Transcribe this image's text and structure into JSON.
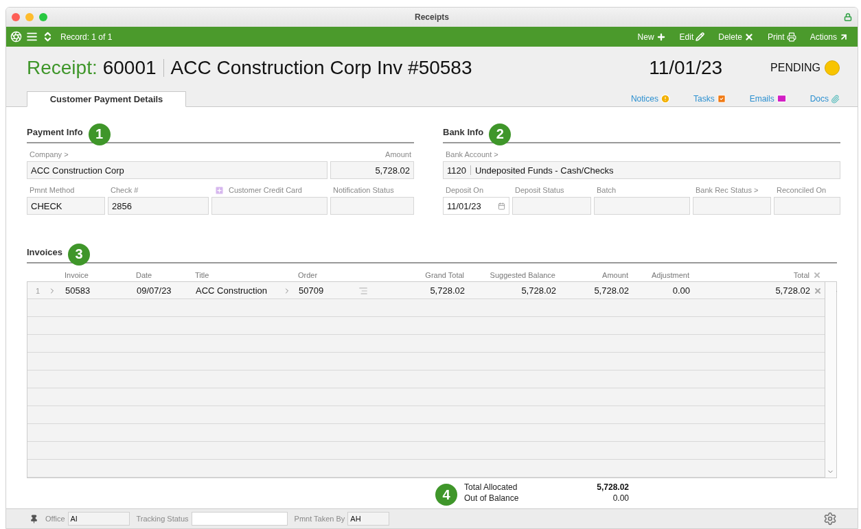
{
  "window": {
    "title": "Receipts"
  },
  "toolbar": {
    "record": "Record: 1 of 1",
    "actions": [
      {
        "label": "New"
      },
      {
        "label": "Edit"
      },
      {
        "label": "Delete"
      },
      {
        "label": "Print"
      },
      {
        "label": "Actions"
      }
    ]
  },
  "header": {
    "prefix": "Receipt:",
    "number": "60001",
    "title": "ACC Construction Corp Inv #50583",
    "date": "11/01/23",
    "status": "PENDING"
  },
  "tabs": [
    {
      "label": "Customer Payment Details",
      "selected": true
    }
  ],
  "links": [
    {
      "label": "Notices"
    },
    {
      "label": "Tasks"
    },
    {
      "label": "Emails"
    },
    {
      "label": "Docs"
    }
  ],
  "sections": [
    {
      "title": "Payment Info",
      "badge": "1",
      "rows": [
        [
          {
            "kind": "text",
            "label": "Company >",
            "value": "ACC Construction Corp"
          },
          {
            "kind": "number",
            "label": "Amount",
            "value": "5,728.02"
          }
        ],
        [
          {
            "kind": "text",
            "label": "Pmnt Method",
            "value": "CHECK"
          },
          {
            "kind": "text",
            "label": "Check #",
            "value": "2856"
          },
          {
            "kind": "card",
            "label": "Customer Credit Card"
          },
          {
            "kind": "text",
            "label": "Notification Status"
          }
        ]
      ]
    },
    {
      "title": "Bank Info",
      "badge": "2",
      "rows": [
        [
          {
            "kind": "split",
            "label": "Bank Account >",
            "values": [
              "1120",
              "Undeposited Funds - Cash/Checks"
            ]
          }
        ],
        [
          {
            "kind": "date",
            "label": "Deposit On",
            "value": "11/01/23"
          },
          {
            "kind": "text",
            "label": "Deposit Status"
          },
          {
            "kind": "text",
            "label": "Batch"
          },
          {
            "kind": "text",
            "label": "Bank Rec Status >"
          },
          {
            "kind": "text",
            "label": "Reconciled On"
          }
        ]
      ]
    }
  ],
  "invoices": {
    "title": "Invoices",
    "badge": "3",
    "columns": [
      "Invoice",
      "Date",
      "Title",
      "Order",
      "Grand Total",
      "Suggested Balance",
      "Amount",
      "Adjustment",
      "Total"
    ],
    "rows": [
      {
        "number": "1",
        "cells": [
          "50583",
          "09/07/23",
          "ACC Construction",
          "50709",
          "5,728.02",
          "5,728.02",
          "5,728.02",
          "0.00",
          "5,728.02"
        ]
      }
    ]
  },
  "totals": {
    "badge": "4",
    "items": [
      {
        "label": "Total Allocated",
        "value": "5,728.02",
        "emphasis": true
      },
      {
        "label": "Out of Balance",
        "value": "0.00",
        "emphasis": false
      }
    ]
  },
  "footer": [
    {
      "label": "Office",
      "value": "AI"
    },
    {
      "label": "Tracking Status"
    },
    {
      "label": "Pmnt Taken By",
      "value": "AH"
    }
  ]
}
